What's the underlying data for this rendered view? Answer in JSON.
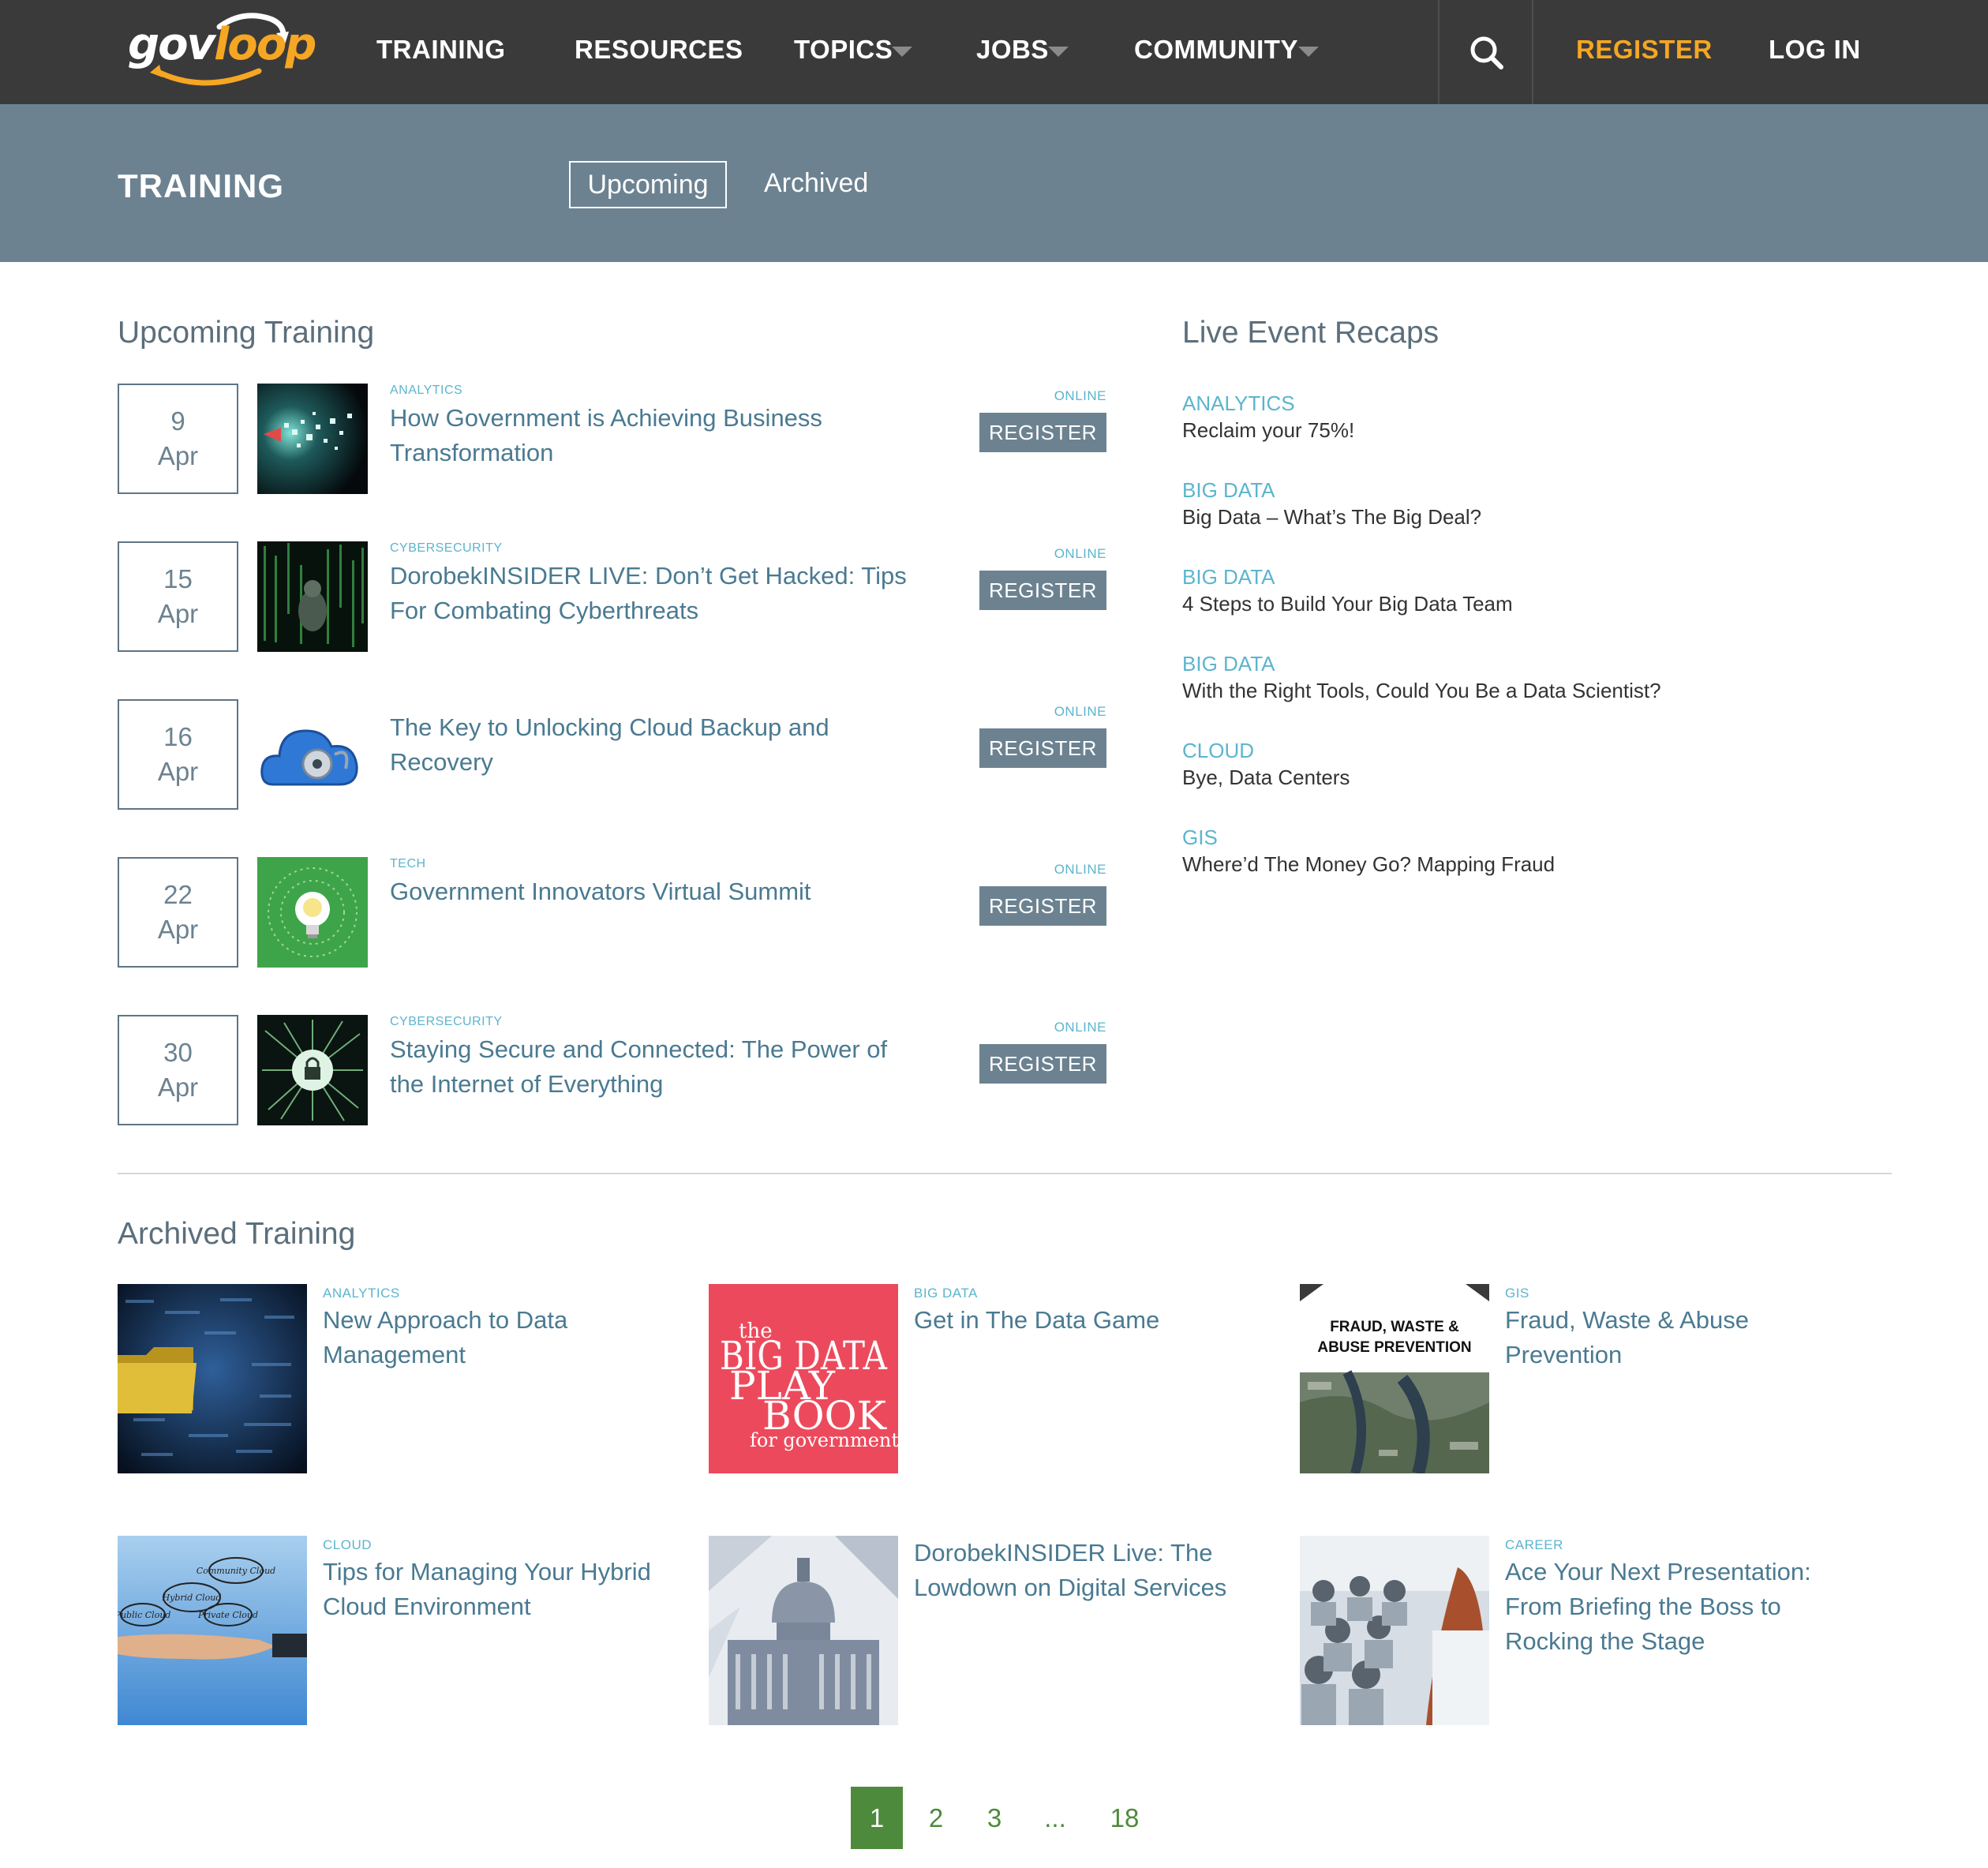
{
  "nav": {
    "logo": "govloop",
    "items": [
      {
        "label": "TRAINING"
      },
      {
        "label": "RESOURCES"
      },
      {
        "label": "TOPICS"
      },
      {
        "label": "JOBS"
      },
      {
        "label": "COMMUNITY"
      }
    ],
    "register": "REGISTER",
    "login": "LOG IN",
    "accent_color": "#f5a623"
  },
  "band": {
    "title": "TRAINING",
    "tabs": [
      {
        "label": "Upcoming",
        "active": true
      },
      {
        "label": "Archived",
        "active": false
      }
    ],
    "color": "#6c8291"
  },
  "upcoming": {
    "heading": "Upcoming Training",
    "events": [
      {
        "day": "9",
        "month": "Apr",
        "category": "ANALYTICS",
        "title": "How Government is Achieving Business Transformation",
        "format": "ONLINE",
        "button": "REGISTER",
        "image": "digital-particles"
      },
      {
        "day": "15",
        "month": "Apr",
        "category": "CYBERSECURITY",
        "title": "DorobekINSIDER LIVE: Don’t Get Hacked: Tips For Combating Cyberthreats",
        "format": "ONLINE",
        "button": "REGISTER",
        "image": "code-matrix"
      },
      {
        "day": "16",
        "month": "Apr",
        "category": "",
        "title": "The Key to Unlocking Cloud Backup and Recovery",
        "format": "ONLINE",
        "button": "REGISTER",
        "image": "cloud-lock"
      },
      {
        "day": "22",
        "month": "Apr",
        "category": "TECH",
        "title": "Government Innovators Virtual Summit",
        "format": "ONLINE",
        "button": "REGISTER",
        "image": "lightbulb"
      },
      {
        "day": "30",
        "month": "Apr",
        "category": "CYBERSECURITY",
        "title": "Staying Secure and Connected: The Power of the Internet of Everything",
        "format": "ONLINE",
        "button": "REGISTER",
        "image": "circuit-lock"
      }
    ]
  },
  "recaps": {
    "heading": "Live Event Recaps",
    "items": [
      {
        "category": "ANALYTICS",
        "title": "Reclaim your 75%!"
      },
      {
        "category": "BIG DATA",
        "title": "Big Data – What’s The Big Deal?"
      },
      {
        "category": "BIG DATA",
        "title": "4 Steps to Build Your Big Data Team"
      },
      {
        "category": "BIG DATA",
        "title": "With the Right Tools, Could You Be a Data Scientist?"
      },
      {
        "category": "CLOUD",
        "title": "Bye, Data Centers"
      },
      {
        "category": "GIS",
        "title": "Where’d The Money Go? Mapping Fraud"
      }
    ]
  },
  "archived": {
    "heading": "Archived Training",
    "items": [
      {
        "category": "ANALYTICS",
        "title": "New Approach to Data Management",
        "image": "data-folder"
      },
      {
        "category": "BIG DATA",
        "title": "Get in The Data Game",
        "image": "big-data-playbook",
        "image_text": {
          "l1": "the",
          "l2": "BIG DATA",
          "l3": "PLAY",
          "l4": "BOOK",
          "l5": "for government"
        }
      },
      {
        "category": "GIS",
        "title": "Fraud, Waste & Abuse Prevention",
        "image": "fraud-waste-map",
        "image_text": {
          "l1": "FRAUD, WASTE &",
          "l2": "ABUSE PREVENTION"
        }
      },
      {
        "category": "CLOUD",
        "title": "Tips for Managing Your Hybrid Cloud Environment",
        "image": "hybrid-cloud-hand",
        "image_text": {
          "c1": "Community Cloud",
          "c2": "Hybrid Cloud",
          "c3": "Public Cloud",
          "c4": "Private Cloud"
        }
      },
      {
        "category": "",
        "title": "DorobekINSIDER Live: The Lowdown on Digital Services",
        "image": "capitol-building"
      },
      {
        "category": "CAREER",
        "title": "Ace Your Next Presentation: From Briefing the Boss to Rocking the Stage",
        "image": "presentation-audience"
      }
    ]
  },
  "pagination": {
    "pages": [
      "1",
      "2",
      "3",
      "...",
      "18"
    ],
    "current": "1",
    "color": "#4e8a3b"
  }
}
